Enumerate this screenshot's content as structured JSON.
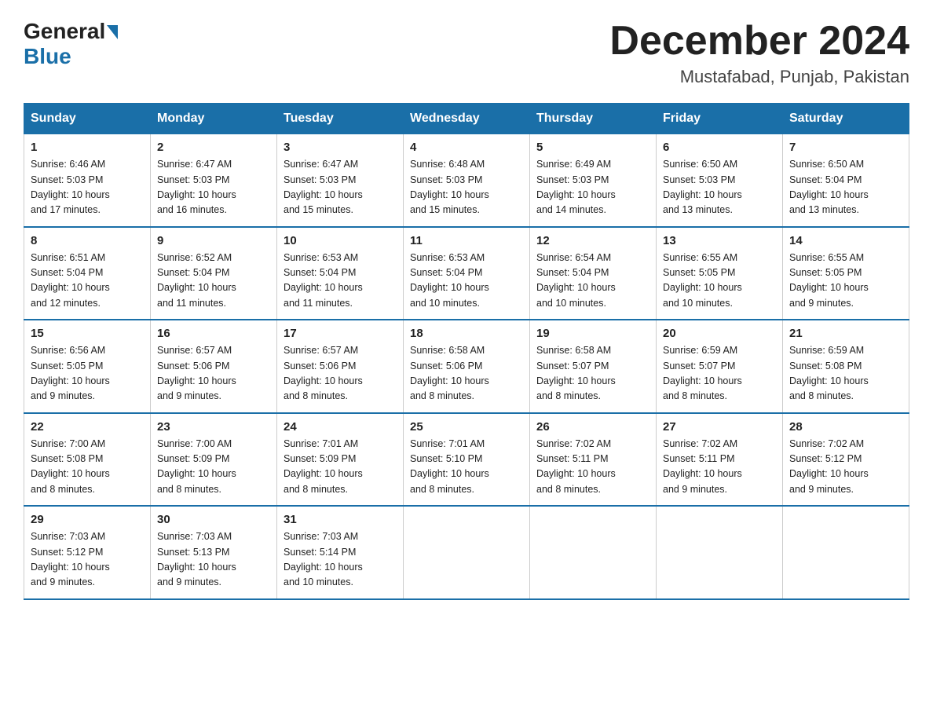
{
  "header": {
    "logo_general": "General",
    "logo_blue": "Blue",
    "month_year": "December 2024",
    "location": "Mustafabad, Punjab, Pakistan"
  },
  "days_of_week": [
    "Sunday",
    "Monday",
    "Tuesday",
    "Wednesday",
    "Thursday",
    "Friday",
    "Saturday"
  ],
  "weeks": [
    [
      {
        "day": "1",
        "sunrise": "6:46 AM",
        "sunset": "5:03 PM",
        "daylight": "10 hours and 17 minutes."
      },
      {
        "day": "2",
        "sunrise": "6:47 AM",
        "sunset": "5:03 PM",
        "daylight": "10 hours and 16 minutes."
      },
      {
        "day": "3",
        "sunrise": "6:47 AM",
        "sunset": "5:03 PM",
        "daylight": "10 hours and 15 minutes."
      },
      {
        "day": "4",
        "sunrise": "6:48 AM",
        "sunset": "5:03 PM",
        "daylight": "10 hours and 15 minutes."
      },
      {
        "day": "5",
        "sunrise": "6:49 AM",
        "sunset": "5:03 PM",
        "daylight": "10 hours and 14 minutes."
      },
      {
        "day": "6",
        "sunrise": "6:50 AM",
        "sunset": "5:03 PM",
        "daylight": "10 hours and 13 minutes."
      },
      {
        "day": "7",
        "sunrise": "6:50 AM",
        "sunset": "5:04 PM",
        "daylight": "10 hours and 13 minutes."
      }
    ],
    [
      {
        "day": "8",
        "sunrise": "6:51 AM",
        "sunset": "5:04 PM",
        "daylight": "10 hours and 12 minutes."
      },
      {
        "day": "9",
        "sunrise": "6:52 AM",
        "sunset": "5:04 PM",
        "daylight": "10 hours and 11 minutes."
      },
      {
        "day": "10",
        "sunrise": "6:53 AM",
        "sunset": "5:04 PM",
        "daylight": "10 hours and 11 minutes."
      },
      {
        "day": "11",
        "sunrise": "6:53 AM",
        "sunset": "5:04 PM",
        "daylight": "10 hours and 10 minutes."
      },
      {
        "day": "12",
        "sunrise": "6:54 AM",
        "sunset": "5:04 PM",
        "daylight": "10 hours and 10 minutes."
      },
      {
        "day": "13",
        "sunrise": "6:55 AM",
        "sunset": "5:05 PM",
        "daylight": "10 hours and 10 minutes."
      },
      {
        "day": "14",
        "sunrise": "6:55 AM",
        "sunset": "5:05 PM",
        "daylight": "10 hours and 9 minutes."
      }
    ],
    [
      {
        "day": "15",
        "sunrise": "6:56 AM",
        "sunset": "5:05 PM",
        "daylight": "10 hours and 9 minutes."
      },
      {
        "day": "16",
        "sunrise": "6:57 AM",
        "sunset": "5:06 PM",
        "daylight": "10 hours and 9 minutes."
      },
      {
        "day": "17",
        "sunrise": "6:57 AM",
        "sunset": "5:06 PM",
        "daylight": "10 hours and 8 minutes."
      },
      {
        "day": "18",
        "sunrise": "6:58 AM",
        "sunset": "5:06 PM",
        "daylight": "10 hours and 8 minutes."
      },
      {
        "day": "19",
        "sunrise": "6:58 AM",
        "sunset": "5:07 PM",
        "daylight": "10 hours and 8 minutes."
      },
      {
        "day": "20",
        "sunrise": "6:59 AM",
        "sunset": "5:07 PM",
        "daylight": "10 hours and 8 minutes."
      },
      {
        "day": "21",
        "sunrise": "6:59 AM",
        "sunset": "5:08 PM",
        "daylight": "10 hours and 8 minutes."
      }
    ],
    [
      {
        "day": "22",
        "sunrise": "7:00 AM",
        "sunset": "5:08 PM",
        "daylight": "10 hours and 8 minutes."
      },
      {
        "day": "23",
        "sunrise": "7:00 AM",
        "sunset": "5:09 PM",
        "daylight": "10 hours and 8 minutes."
      },
      {
        "day": "24",
        "sunrise": "7:01 AM",
        "sunset": "5:09 PM",
        "daylight": "10 hours and 8 minutes."
      },
      {
        "day": "25",
        "sunrise": "7:01 AM",
        "sunset": "5:10 PM",
        "daylight": "10 hours and 8 minutes."
      },
      {
        "day": "26",
        "sunrise": "7:02 AM",
        "sunset": "5:11 PM",
        "daylight": "10 hours and 8 minutes."
      },
      {
        "day": "27",
        "sunrise": "7:02 AM",
        "sunset": "5:11 PM",
        "daylight": "10 hours and 9 minutes."
      },
      {
        "day": "28",
        "sunrise": "7:02 AM",
        "sunset": "5:12 PM",
        "daylight": "10 hours and 9 minutes."
      }
    ],
    [
      {
        "day": "29",
        "sunrise": "7:03 AM",
        "sunset": "5:12 PM",
        "daylight": "10 hours and 9 minutes."
      },
      {
        "day": "30",
        "sunrise": "7:03 AM",
        "sunset": "5:13 PM",
        "daylight": "10 hours and 9 minutes."
      },
      {
        "day": "31",
        "sunrise": "7:03 AM",
        "sunset": "5:14 PM",
        "daylight": "10 hours and 10 minutes."
      },
      null,
      null,
      null,
      null
    ]
  ],
  "labels": {
    "sunrise": "Sunrise:",
    "sunset": "Sunset:",
    "daylight": "Daylight:"
  }
}
